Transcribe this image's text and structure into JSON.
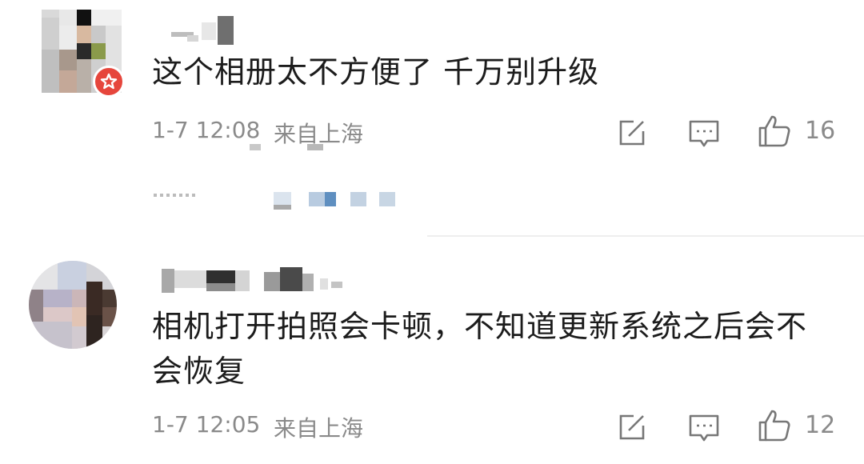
{
  "comments": [
    {
      "text": "这个相册太不方便了 千万别升级",
      "time": "1-7 12:08",
      "location": "来自上海",
      "likes": "16",
      "icons": {
        "repost": "edit-icon",
        "reply": "comment-icon",
        "like": "thumbs-up-icon"
      }
    },
    {
      "text_line1": "相机打开拍照会卡顿，不知道更新系统之后会不",
      "text_line2": "会恢复",
      "time": "1-7 12:05",
      "location": "来自上海",
      "likes": "12",
      "icons": {
        "repost": "edit-icon",
        "reply": "comment-icon",
        "like": "thumbs-up-icon"
      }
    }
  ],
  "colors": {
    "meta": "#8a8a8a",
    "text": "#1c1c1c",
    "badge": "#e6463c",
    "divider": "#eeeeee"
  }
}
